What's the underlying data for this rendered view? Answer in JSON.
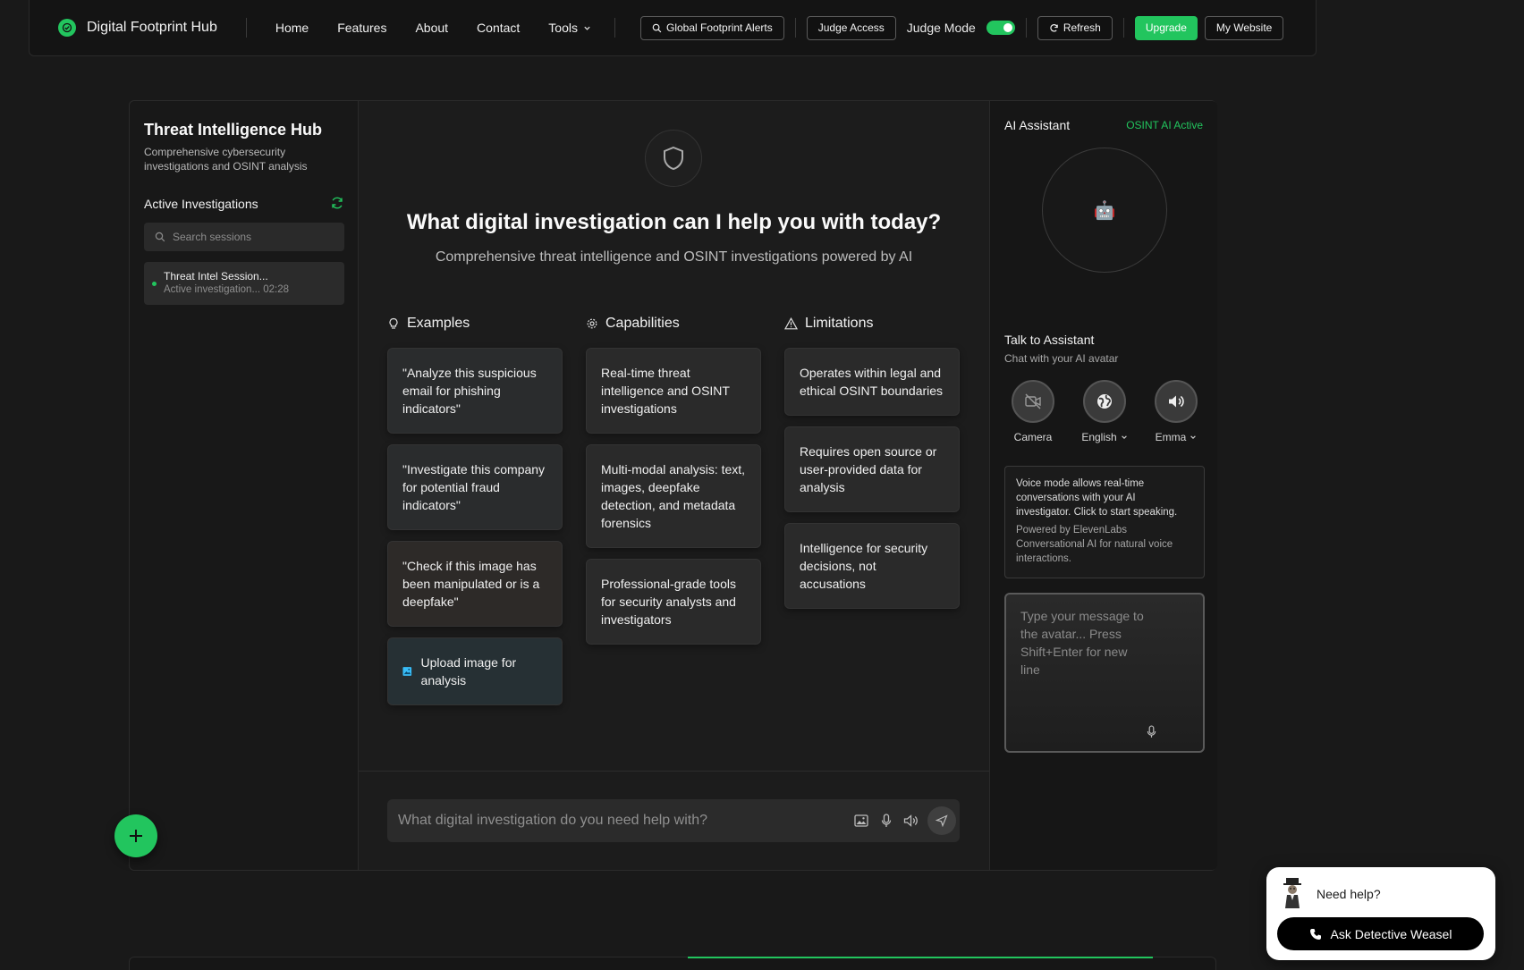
{
  "nav": {
    "brand": "Digital Footprint Hub",
    "links": [
      "Home",
      "Features",
      "About",
      "Contact",
      "Tools"
    ],
    "alerts_button": "Global Footprint Alerts",
    "judge_access": "Judge Access",
    "judge_mode_label": "Judge Mode",
    "judge_mode_on": true,
    "refresh": "Refresh",
    "upgrade": "Upgrade",
    "my_website": "My Website"
  },
  "sidebar": {
    "title": "Threat Intelligence Hub",
    "subtitle": "Comprehensive cybersecurity investigations and OSINT analysis",
    "active_label": "Active Investigations",
    "search_placeholder": "Search sessions",
    "sessions": [
      {
        "title": "Threat Intel Session...",
        "subtitle": "Active investigation... 02:28"
      }
    ]
  },
  "main": {
    "headline": "What digital investigation can I help you with today?",
    "subheadline": "Comprehensive threat intelligence and OSINT investigations powered by AI",
    "examples": {
      "title": "Examples",
      "items": [
        "\"Analyze this suspicious email for phishing indicators\"",
        "\"Investigate this company for potential fraud indicators\"",
        "\"Check if this image has been manipulated or is a deepfake\""
      ],
      "upload": "Upload image for analysis"
    },
    "capabilities": {
      "title": "Capabilities",
      "items": [
        "Real-time threat intelligence and OSINT investigations",
        "Multi-modal analysis: text, images, deepfake detection, and metadata forensics",
        "Professional-grade tools for security analysts and investigators"
      ]
    },
    "limitations": {
      "title": "Limitations",
      "items": [
        "Operates within legal and ethical OSINT boundaries",
        "Requires open source or user-provided data for analysis",
        "Intelligence for security decisions, not accusations"
      ]
    },
    "composer_placeholder": "What digital investigation do you need help with?"
  },
  "assistant": {
    "title": "AI Assistant",
    "status": "OSINT AI Active",
    "avatar_glyph": "🤖",
    "talk_title": "Talk to Assistant",
    "talk_subtitle": "Chat with your AI avatar",
    "controls": {
      "camera": "Camera",
      "language": "English",
      "voice": "Emma"
    },
    "info_main": "Voice mode allows real-time conversations with your AI investigator. Click to start speaking.",
    "info_sub": "Powered by ElevenLabs Conversational AI for natural voice interactions.",
    "message_placeholder": "Type your message to the avatar... Press Shift+Enter for new line"
  },
  "help": {
    "text": "Need help?",
    "button": "Ask Detective Weasel"
  },
  "colors": {
    "accent": "#22c55e",
    "background": "#191919"
  }
}
